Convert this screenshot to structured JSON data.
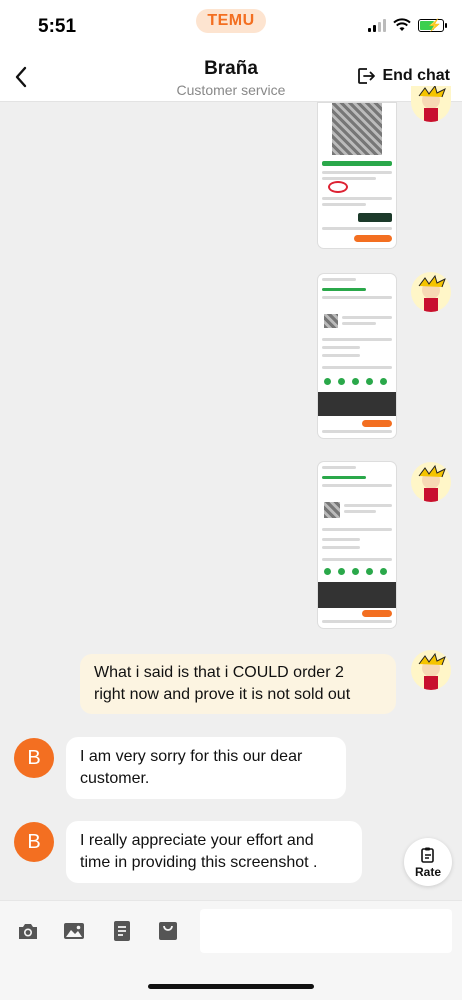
{
  "status": {
    "time": "5:51",
    "brand": "TEMU"
  },
  "header": {
    "title": "Braña",
    "subtitle": "Customer service",
    "end_chat_label": "End chat"
  },
  "messages": [
    {
      "from": "me",
      "type": "image"
    },
    {
      "from": "me",
      "type": "image"
    },
    {
      "from": "me",
      "type": "image"
    },
    {
      "from": "me",
      "type": "text",
      "lines": [
        "What i said is that i COULD order 2",
        "right now and prove it is not sold out"
      ]
    },
    {
      "from": "agent",
      "type": "text",
      "lines": [
        "I am very sorry for this our dear",
        "customer."
      ]
    },
    {
      "from": "agent",
      "type": "text",
      "lines": [
        "I really appreciate your effort and",
        "time in providing this screenshot ."
      ]
    }
  ],
  "agent_avatar_letter": "B",
  "rate": {
    "label": "Rate"
  },
  "composer": {
    "placeholder": "",
    "tools": [
      "camera-icon",
      "image-icon",
      "order-list-icon",
      "bag-icon"
    ]
  },
  "colors": {
    "brand": "#f36f21",
    "my_bubble": "#fcf4e1",
    "agent_bubble": "#ffffff",
    "background": "#efefef"
  }
}
